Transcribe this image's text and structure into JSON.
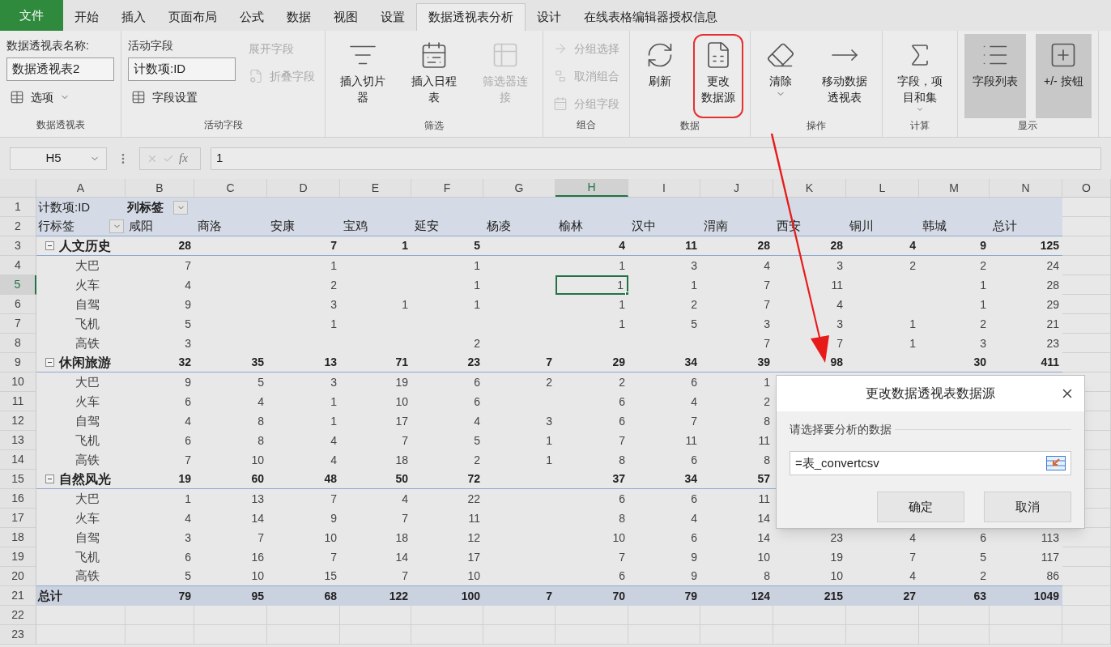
{
  "menu_tabs": [
    {
      "label": "文件",
      "kind": "file",
      "selected": false
    },
    {
      "label": "开始",
      "kind": "tab",
      "selected": false
    },
    {
      "label": "插入",
      "kind": "tab",
      "selected": false
    },
    {
      "label": "页面布局",
      "kind": "tab",
      "selected": false
    },
    {
      "label": "公式",
      "kind": "tab",
      "selected": false
    },
    {
      "label": "数据",
      "kind": "tab",
      "selected": false
    },
    {
      "label": "视图",
      "kind": "tab",
      "selected": false
    },
    {
      "label": "设置",
      "kind": "tab",
      "selected": false
    },
    {
      "label": "数据透视表分析",
      "kind": "tab",
      "selected": true
    },
    {
      "label": "设计",
      "kind": "tab",
      "selected": false
    },
    {
      "label": "在线表格编辑器授权信息",
      "kind": "tab",
      "selected": false
    }
  ],
  "ribbon": {
    "groups": [
      {
        "label": "数据透视表",
        "columns": [
          [
            {
              "kind": "field",
              "caption": "数据透视表名称:",
              "value": "数据透视表2"
            },
            {
              "kind": "small",
              "label": "选项",
              "disabled": false,
              "dropdown": true
            }
          ]
        ]
      },
      {
        "label": "活动字段",
        "columns": [
          [
            {
              "kind": "field",
              "caption": "活动字段",
              "value": "计数项:ID"
            },
            {
              "kind": "small",
              "label": "字段设置",
              "disabled": false,
              "dropdown": false
            }
          ],
          [
            {
              "kind": "small",
              "label": "展开字段",
              "disabled": true,
              "dropdown": false
            },
            {
              "kind": "small",
              "label": "折叠字段",
              "disabled": true,
              "dropdown": false
            }
          ]
        ]
      },
      {
        "label": "筛选",
        "columns": [
          [
            {
              "kind": "large",
              "lines": [
                "插入切片",
                "器"
              ],
              "disabled": false,
              "on": false,
              "circled": false,
              "dropdown": false
            }
          ],
          [
            {
              "kind": "large",
              "lines": [
                "插入日程",
                "表"
              ],
              "disabled": false,
              "on": false,
              "circled": false,
              "dropdown": false
            }
          ],
          [
            {
              "kind": "large",
              "lines": [
                "筛选器连",
                "接"
              ],
              "disabled": true,
              "on": false,
              "circled": false,
              "dropdown": false
            }
          ]
        ]
      },
      {
        "label": "组合",
        "columns": [
          [
            {
              "kind": "small",
              "label": "分组选择",
              "disabled": true,
              "dropdown": false
            },
            {
              "kind": "small",
              "label": "取消组合",
              "disabled": true,
              "dropdown": false
            },
            {
              "kind": "small",
              "label": "分组字段",
              "disabled": true,
              "dropdown": false
            }
          ]
        ]
      },
      {
        "label": "数据",
        "columns": [
          [
            {
              "kind": "large",
              "lines": [
                "刷新"
              ],
              "disabled": false,
              "on": false,
              "circled": false,
              "dropdown": false
            }
          ],
          [
            {
              "kind": "large",
              "lines": [
                "更改",
                "数据源"
              ],
              "disabled": false,
              "on": false,
              "circled": true,
              "dropdown": false
            }
          ]
        ]
      },
      {
        "label": "操作",
        "columns": [
          [
            {
              "kind": "large",
              "lines": [
                "清除"
              ],
              "disabled": false,
              "on": false,
              "circled": false,
              "dropdown": true
            }
          ],
          [
            {
              "kind": "large",
              "lines": [
                "移动数据",
                "透视表"
              ],
              "disabled": false,
              "on": false,
              "circled": false,
              "dropdown": false
            }
          ]
        ]
      },
      {
        "label": "计算",
        "columns": [
          [
            {
              "kind": "large",
              "lines": [
                "字段，项",
                "目和集"
              ],
              "disabled": false,
              "on": false,
              "circled": false,
              "dropdown": true
            }
          ]
        ]
      },
      {
        "label": "显示",
        "columns": [
          [
            {
              "kind": "large",
              "lines": [
                "字段列表"
              ],
              "disabled": false,
              "on": true,
              "circled": false,
              "dropdown": false
            }
          ],
          [
            {
              "kind": "large",
              "lines": [
                "+/- 按钮"
              ],
              "disabled": false,
              "on": true,
              "circled": false,
              "dropdown": false
            }
          ]
        ]
      }
    ]
  },
  "formula_bar": {
    "name_box": "H5",
    "function_label": "fx",
    "formula": "1"
  },
  "columns": [
    {
      "label": "A",
      "selected": false
    },
    {
      "label": "B",
      "selected": false
    },
    {
      "label": "C",
      "selected": false
    },
    {
      "label": "D",
      "selected": false
    },
    {
      "label": "E",
      "selected": false
    },
    {
      "label": "F",
      "selected": false
    },
    {
      "label": "G",
      "selected": false
    },
    {
      "label": "H",
      "selected": true
    },
    {
      "label": "I",
      "selected": false
    },
    {
      "label": "J",
      "selected": false
    },
    {
      "label": "K",
      "selected": false
    },
    {
      "label": "L",
      "selected": false
    },
    {
      "label": "M",
      "selected": false
    },
    {
      "label": "N",
      "selected": false
    },
    {
      "label": "O",
      "selected": false
    }
  ],
  "rows": [
    {
      "number": "1",
      "selected": false,
      "kind": "column_labels",
      "label": "计数项:ID",
      "cells": {
        "B": "列标签"
      }
    },
    {
      "number": "2",
      "selected": false,
      "kind": "row_labels",
      "label": "行标签",
      "cells": {
        "B": "咸阳",
        "C": "商洛",
        "D": "安康",
        "E": "宝鸡",
        "F": "延安",
        "G": "杨凌",
        "H": "榆林",
        "I": "汉中",
        "J": "渭南",
        "K": "西安",
        "L": "铜川",
        "M": "韩城",
        "N": "总计"
      }
    },
    {
      "number": "3",
      "selected": false,
      "kind": "group",
      "expanded": true,
      "label": "人文历史",
      "cells": {
        "B": "28",
        "D": "7",
        "E": "1",
        "F": "5",
        "H": "4",
        "I": "11",
        "J": "28",
        "K": "28",
        "L": "4",
        "M": "9",
        "N": "125"
      }
    },
    {
      "number": "4",
      "selected": false,
      "kind": "item",
      "label": "大巴",
      "cells": {
        "B": "7",
        "D": "1",
        "F": "1",
        "H": "1",
        "I": "3",
        "J": "4",
        "K": "3",
        "L": "2",
        "M": "2",
        "N": "24"
      }
    },
    {
      "number": "5",
      "selected": true,
      "kind": "item",
      "label": "火车",
      "cells": {
        "B": "4",
        "D": "2",
        "F": "1",
        "H": "1",
        "I": "1",
        "J": "7",
        "K": "11",
        "M": "1",
        "N": "28"
      }
    },
    {
      "number": "6",
      "selected": false,
      "kind": "item",
      "label": "自驾",
      "cells": {
        "B": "9",
        "D": "3",
        "E": "1",
        "F": "1",
        "H": "1",
        "I": "2",
        "J": "7",
        "K": "4",
        "M": "1",
        "N": "29"
      }
    },
    {
      "number": "7",
      "selected": false,
      "kind": "item",
      "label": "飞机",
      "cells": {
        "B": "5",
        "D": "1",
        "H": "1",
        "I": "5",
        "J": "3",
        "K": "3",
        "L": "1",
        "M": "2",
        "N": "21"
      }
    },
    {
      "number": "8",
      "selected": false,
      "kind": "item",
      "label": "高铁",
      "cells": {
        "B": "3",
        "F": "2",
        "J": "7",
        "K": "7",
        "L": "1",
        "M": "3",
        "N": "23"
      }
    },
    {
      "number": "9",
      "selected": false,
      "kind": "group",
      "expanded": true,
      "label": "休闲旅游",
      "cells": {
        "B": "32",
        "C": "35",
        "D": "13",
        "E": "71",
        "F": "23",
        "G": "7",
        "H": "29",
        "I": "34",
        "J": "39",
        "K": "98",
        "M": "30",
        "N": "411"
      }
    },
    {
      "number": "10",
      "selected": false,
      "kind": "item",
      "label": "大巴",
      "cells": {
        "B": "9",
        "C": "5",
        "D": "3",
        "E": "19",
        "F": "6",
        "G": "2",
        "H": "2",
        "I": "6",
        "J": "1"
      }
    },
    {
      "number": "11",
      "selected": false,
      "kind": "item",
      "label": "火车",
      "cells": {
        "B": "6",
        "C": "4",
        "D": "1",
        "E": "10",
        "F": "6",
        "H": "6",
        "I": "4",
        "J": "2"
      }
    },
    {
      "number": "12",
      "selected": false,
      "kind": "item",
      "label": "自驾",
      "cells": {
        "B": "4",
        "C": "8",
        "D": "1",
        "E": "17",
        "F": "4",
        "G": "3",
        "H": "6",
        "I": "7",
        "J": "8"
      }
    },
    {
      "number": "13",
      "selected": false,
      "kind": "item",
      "label": "飞机",
      "cells": {
        "B": "6",
        "C": "8",
        "D": "4",
        "E": "7",
        "F": "5",
        "G": "1",
        "H": "7",
        "I": "11",
        "J": "11"
      }
    },
    {
      "number": "14",
      "selected": false,
      "kind": "item",
      "label": "高铁",
      "cells": {
        "B": "7",
        "C": "10",
        "D": "4",
        "E": "18",
        "F": "2",
        "G": "1",
        "H": "8",
        "I": "6",
        "J": "8"
      }
    },
    {
      "number": "15",
      "selected": false,
      "kind": "group",
      "expanded": true,
      "label": "自然风光",
      "cells": {
        "B": "19",
        "C": "60",
        "D": "48",
        "E": "50",
        "F": "72",
        "H": "37",
        "I": "34",
        "J": "57"
      }
    },
    {
      "number": "16",
      "selected": false,
      "kind": "item",
      "label": "大巴",
      "cells": {
        "B": "1",
        "C": "13",
        "D": "7",
        "E": "4",
        "F": "22",
        "H": "6",
        "I": "6",
        "J": "11"
      }
    },
    {
      "number": "17",
      "selected": false,
      "kind": "item",
      "label": "火车",
      "cells": {
        "B": "4",
        "C": "14",
        "D": "9",
        "E": "7",
        "F": "11",
        "H": "8",
        "I": "4",
        "J": "14"
      }
    },
    {
      "number": "18",
      "selected": false,
      "kind": "item",
      "label": "自驾",
      "cells": {
        "B": "3",
        "C": "7",
        "D": "10",
        "E": "18",
        "F": "12",
        "H": "10",
        "I": "6",
        "J": "14",
        "K": "23",
        "L": "4",
        "M": "6",
        "N": "113"
      }
    },
    {
      "number": "19",
      "selected": false,
      "kind": "item",
      "label": "飞机",
      "cells": {
        "B": "6",
        "C": "16",
        "D": "7",
        "E": "14",
        "F": "17",
        "H": "7",
        "I": "9",
        "J": "10",
        "K": "19",
        "L": "7",
        "M": "5",
        "N": "117"
      }
    },
    {
      "number": "20",
      "selected": false,
      "kind": "item",
      "label": "高铁",
      "cells": {
        "B": "5",
        "C": "10",
        "D": "15",
        "E": "7",
        "F": "10",
        "H": "6",
        "I": "9",
        "J": "8",
        "K": "10",
        "L": "4",
        "M": "2",
        "N": "86"
      }
    },
    {
      "number": "21",
      "selected": false,
      "kind": "total",
      "label": "总计",
      "cells": {
        "B": "79",
        "C": "95",
        "D": "68",
        "E": "122",
        "F": "100",
        "G": "7",
        "H": "70",
        "I": "79",
        "J": "124",
        "K": "215",
        "L": "27",
        "M": "63",
        "N": "1049"
      }
    },
    {
      "number": "22",
      "selected": false,
      "kind": "empty"
    },
    {
      "number": "23",
      "selected": false,
      "kind": "empty"
    }
  ],
  "dialog": {
    "title": "更改数据透视表数据源",
    "section_label": "请选择要分析的数据",
    "input_value": "=表_convertcsv",
    "buttons": [
      "确定",
      "取消"
    ]
  }
}
